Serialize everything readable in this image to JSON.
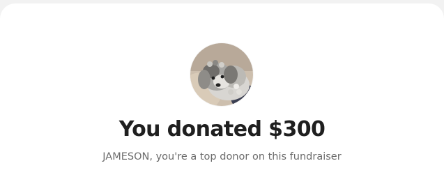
{
  "donation": {
    "headline": "You donated $300",
    "subline": "JAMESON, you're a top donor on this fundraiser",
    "avatar_icon": "dog-photo-avatar"
  },
  "colors": {
    "background": "#f2f2f2",
    "card": "#ffffff",
    "headline": "#1f1f1f",
    "subline": "#6b6b6b"
  }
}
